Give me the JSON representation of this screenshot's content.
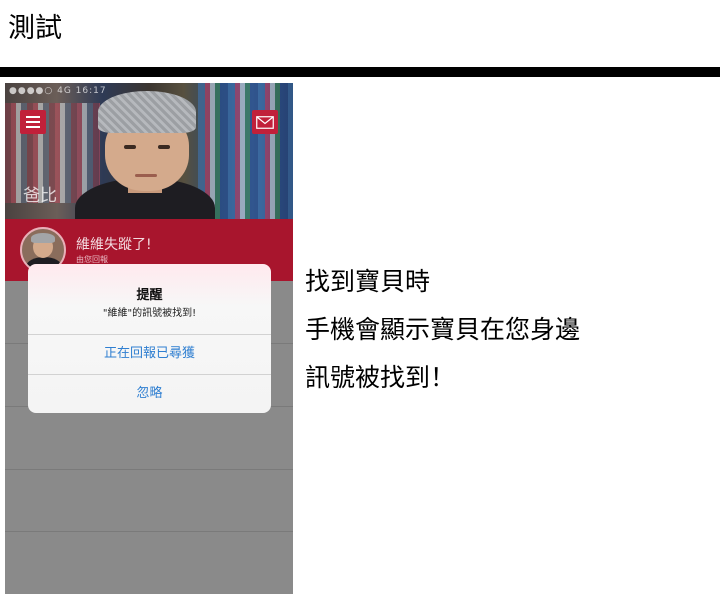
{
  "page": {
    "title": "測試"
  },
  "phone": {
    "status_bar": "●●●●○  4G  16:17",
    "hero": {
      "name": "爸比"
    },
    "alert_bar": {
      "title": "維維失蹤了!",
      "subtitle": "由您回報"
    },
    "dialog": {
      "title": "提醒",
      "message": "\"維維\"的訊號被找到!",
      "primary_button": "正在回報已尋獲",
      "secondary_button": "忽略"
    },
    "colors": {
      "accent_red": "#a8152d",
      "button_red": "#c1203a",
      "link_blue": "#2f7fd1"
    }
  },
  "caption": {
    "lines": [
      "找到寶貝時",
      "手機會顯示寶貝在您身邊",
      "訊號被找到！"
    ]
  }
}
